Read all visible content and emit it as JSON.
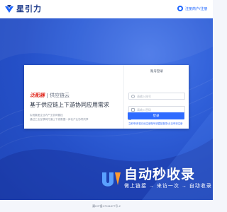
{
  "header": {
    "logo_text": "星引力",
    "top_link_label": "注册商户/注册"
  },
  "card": {
    "brand_red": "泛配器",
    "brand_gray": "供应链云",
    "headline": "基于供应链上下游协同应用需求",
    "line1": "实现集团企业内产业协同管控",
    "line2": "通过工业互联网打通上下游数据一体化产业协同共享"
  },
  "login": {
    "title": "账号登录",
    "username_placeholder": "请输入账号",
    "password_placeholder": "请输入密码",
    "remember_label": "记住密码",
    "register_tip": "立即申请/如已经注册账号请直接登录/点击申请注册",
    "submit_label": "登录"
  },
  "watermark": {
    "title": "自动秒收录",
    "subtitle": "做上链接 → 来访一次 → 自动收录"
  },
  "footer": {
    "icp": "冀ICP备17011877号-2"
  },
  "colors": {
    "brand_blue": "#1d3a8a",
    "accent_blue": "#2f6bff",
    "brand_red": "#e0281e",
    "hero_blue": "#2550c8"
  }
}
